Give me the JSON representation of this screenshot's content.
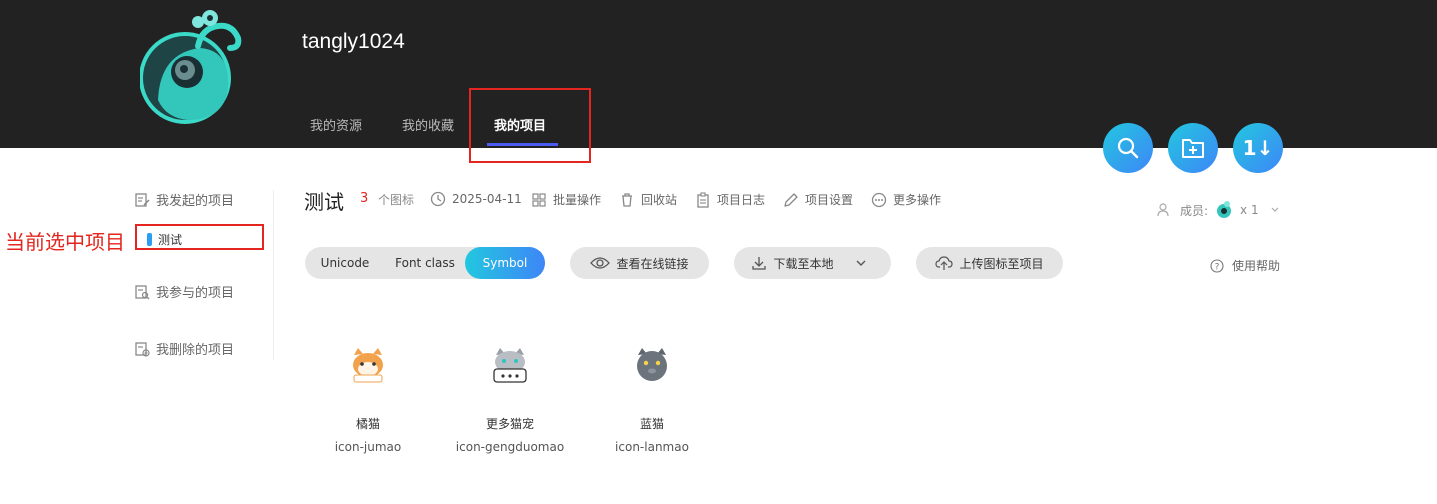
{
  "header": {
    "username": "tangly1024",
    "tabs": [
      {
        "label": "我的资源"
      },
      {
        "label": "我的收藏"
      },
      {
        "label": "我的项目"
      }
    ]
  },
  "annotation": {
    "label": "当前选中项目"
  },
  "fab": {
    "search_icon": "search-icon",
    "new_folder_icon": "folder-plus-icon",
    "sort_label": "1↓"
  },
  "sidebar": {
    "items": [
      {
        "label": "我发起的项目"
      },
      {
        "label": "测试"
      },
      {
        "label": "我参与的项目"
      },
      {
        "label": "我删除的项目"
      }
    ]
  },
  "project": {
    "title": "测试",
    "icon_count": "3",
    "icon_count_label": "个图标",
    "date": "2025-04-11",
    "batch": "批量操作",
    "recycle": "回收站",
    "log": "项目日志",
    "settings": "项目设置",
    "more": "更多操作",
    "members_label": "成员:",
    "members_count": "x 1"
  },
  "toolbar": {
    "tabs": [
      {
        "label": "Unicode"
      },
      {
        "label": "Font class"
      },
      {
        "label": "Symbol"
      }
    ],
    "view_link": "查看在线链接",
    "download": "下载至本地",
    "upload": "上传图标至项目",
    "help": "使用帮助"
  },
  "icons": [
    {
      "name": "橘猫",
      "code": "icon-jumao"
    },
    {
      "name": "更多猫宠",
      "code": "icon-gengduomao"
    },
    {
      "name": "蓝猫",
      "code": "icon-lanmao"
    }
  ],
  "colors": {
    "accent": "#3e86f7",
    "annotation": "#e3261f",
    "header_bg": "#222222"
  }
}
